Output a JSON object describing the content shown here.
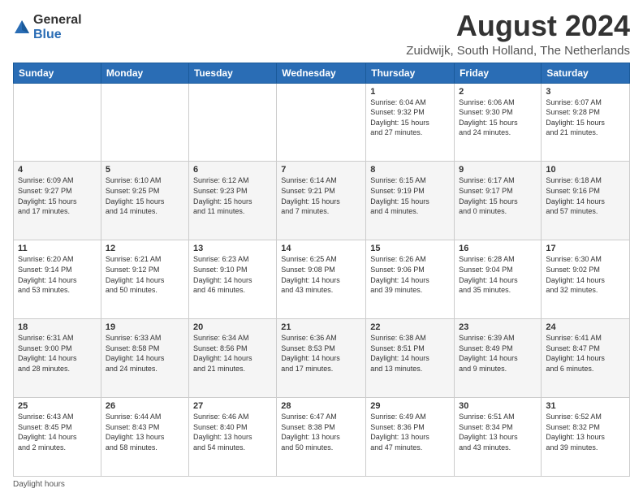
{
  "logo": {
    "general": "General",
    "blue": "Blue"
  },
  "header": {
    "title": "August 2024",
    "subtitle": "Zuidwijk, South Holland, The Netherlands"
  },
  "columns": [
    "Sunday",
    "Monday",
    "Tuesday",
    "Wednesday",
    "Thursday",
    "Friday",
    "Saturday"
  ],
  "weeks": [
    [
      {
        "day": "",
        "info": ""
      },
      {
        "day": "",
        "info": ""
      },
      {
        "day": "",
        "info": ""
      },
      {
        "day": "",
        "info": ""
      },
      {
        "day": "1",
        "info": "Sunrise: 6:04 AM\nSunset: 9:32 PM\nDaylight: 15 hours\nand 27 minutes."
      },
      {
        "day": "2",
        "info": "Sunrise: 6:06 AM\nSunset: 9:30 PM\nDaylight: 15 hours\nand 24 minutes."
      },
      {
        "day": "3",
        "info": "Sunrise: 6:07 AM\nSunset: 9:28 PM\nDaylight: 15 hours\nand 21 minutes."
      }
    ],
    [
      {
        "day": "4",
        "info": "Sunrise: 6:09 AM\nSunset: 9:27 PM\nDaylight: 15 hours\nand 17 minutes."
      },
      {
        "day": "5",
        "info": "Sunrise: 6:10 AM\nSunset: 9:25 PM\nDaylight: 15 hours\nand 14 minutes."
      },
      {
        "day": "6",
        "info": "Sunrise: 6:12 AM\nSunset: 9:23 PM\nDaylight: 15 hours\nand 11 minutes."
      },
      {
        "day": "7",
        "info": "Sunrise: 6:14 AM\nSunset: 9:21 PM\nDaylight: 15 hours\nand 7 minutes."
      },
      {
        "day": "8",
        "info": "Sunrise: 6:15 AM\nSunset: 9:19 PM\nDaylight: 15 hours\nand 4 minutes."
      },
      {
        "day": "9",
        "info": "Sunrise: 6:17 AM\nSunset: 9:17 PM\nDaylight: 15 hours\nand 0 minutes."
      },
      {
        "day": "10",
        "info": "Sunrise: 6:18 AM\nSunset: 9:16 PM\nDaylight: 14 hours\nand 57 minutes."
      }
    ],
    [
      {
        "day": "11",
        "info": "Sunrise: 6:20 AM\nSunset: 9:14 PM\nDaylight: 14 hours\nand 53 minutes."
      },
      {
        "day": "12",
        "info": "Sunrise: 6:21 AM\nSunset: 9:12 PM\nDaylight: 14 hours\nand 50 minutes."
      },
      {
        "day": "13",
        "info": "Sunrise: 6:23 AM\nSunset: 9:10 PM\nDaylight: 14 hours\nand 46 minutes."
      },
      {
        "day": "14",
        "info": "Sunrise: 6:25 AM\nSunset: 9:08 PM\nDaylight: 14 hours\nand 43 minutes."
      },
      {
        "day": "15",
        "info": "Sunrise: 6:26 AM\nSunset: 9:06 PM\nDaylight: 14 hours\nand 39 minutes."
      },
      {
        "day": "16",
        "info": "Sunrise: 6:28 AM\nSunset: 9:04 PM\nDaylight: 14 hours\nand 35 minutes."
      },
      {
        "day": "17",
        "info": "Sunrise: 6:30 AM\nSunset: 9:02 PM\nDaylight: 14 hours\nand 32 minutes."
      }
    ],
    [
      {
        "day": "18",
        "info": "Sunrise: 6:31 AM\nSunset: 9:00 PM\nDaylight: 14 hours\nand 28 minutes."
      },
      {
        "day": "19",
        "info": "Sunrise: 6:33 AM\nSunset: 8:58 PM\nDaylight: 14 hours\nand 24 minutes."
      },
      {
        "day": "20",
        "info": "Sunrise: 6:34 AM\nSunset: 8:56 PM\nDaylight: 14 hours\nand 21 minutes."
      },
      {
        "day": "21",
        "info": "Sunrise: 6:36 AM\nSunset: 8:53 PM\nDaylight: 14 hours\nand 17 minutes."
      },
      {
        "day": "22",
        "info": "Sunrise: 6:38 AM\nSunset: 8:51 PM\nDaylight: 14 hours\nand 13 minutes."
      },
      {
        "day": "23",
        "info": "Sunrise: 6:39 AM\nSunset: 8:49 PM\nDaylight: 14 hours\nand 9 minutes."
      },
      {
        "day": "24",
        "info": "Sunrise: 6:41 AM\nSunset: 8:47 PM\nDaylight: 14 hours\nand 6 minutes."
      }
    ],
    [
      {
        "day": "25",
        "info": "Sunrise: 6:43 AM\nSunset: 8:45 PM\nDaylight: 14 hours\nand 2 minutes."
      },
      {
        "day": "26",
        "info": "Sunrise: 6:44 AM\nSunset: 8:43 PM\nDaylight: 13 hours\nand 58 minutes."
      },
      {
        "day": "27",
        "info": "Sunrise: 6:46 AM\nSunset: 8:40 PM\nDaylight: 13 hours\nand 54 minutes."
      },
      {
        "day": "28",
        "info": "Sunrise: 6:47 AM\nSunset: 8:38 PM\nDaylight: 13 hours\nand 50 minutes."
      },
      {
        "day": "29",
        "info": "Sunrise: 6:49 AM\nSunset: 8:36 PM\nDaylight: 13 hours\nand 47 minutes."
      },
      {
        "day": "30",
        "info": "Sunrise: 6:51 AM\nSunset: 8:34 PM\nDaylight: 13 hours\nand 43 minutes."
      },
      {
        "day": "31",
        "info": "Sunrise: 6:52 AM\nSunset: 8:32 PM\nDaylight: 13 hours\nand 39 minutes."
      }
    ]
  ],
  "footer": {
    "note": "Daylight hours"
  }
}
